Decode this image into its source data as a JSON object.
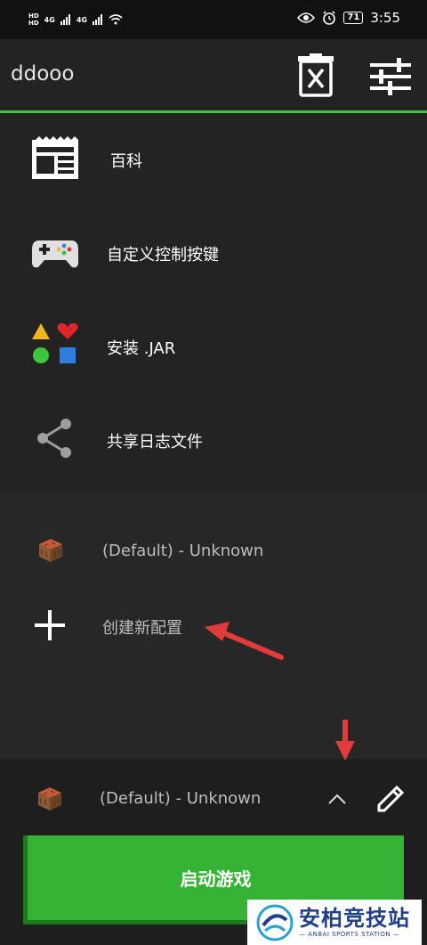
{
  "status_bar": {
    "hd_label": "HD",
    "signal_label_1": "4G",
    "signal_label_2": "4G",
    "battery": "71",
    "time": "3:55"
  },
  "app_bar": {
    "title": "ddooo",
    "actions": [
      "delete-icon",
      "sliders-icon"
    ]
  },
  "menu": {
    "items": [
      {
        "label": "百科",
        "icon": "news-icon"
      },
      {
        "label": "自定义控制按键",
        "icon": "gamepad-icon"
      },
      {
        "label": "安装 .JAR",
        "icon": "shapes-icon"
      },
      {
        "label": "共享日志文件",
        "icon": "share-icon"
      }
    ]
  },
  "profiles": {
    "items": [
      {
        "label": "(Default) - Unknown",
        "icon": "crafting-block-icon"
      },
      {
        "label": "创建新配置",
        "icon": "plus-icon"
      }
    ]
  },
  "bottom": {
    "selected_profile": "(Default) - Unknown",
    "launch_label": "启动游戏"
  },
  "watermark": {
    "main": "安柏竞技站",
    "sub": "— ANBAI SPORTS STATION —"
  },
  "colors": {
    "accent": "#3cc63c",
    "launch": "#35b335",
    "arrow": "#e23b3b"
  }
}
